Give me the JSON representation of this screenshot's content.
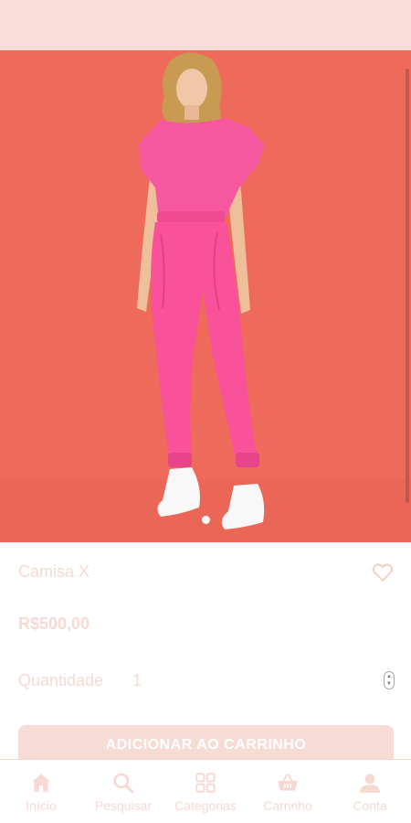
{
  "product": {
    "name": "Camisa X",
    "price": "R$500,00",
    "quantity_label": "Quantidade",
    "quantity_value": "1",
    "add_to_cart_label": "ADICIONAR AO CARRINHO",
    "image_icon": "pink-jumpsuit-photo",
    "carousel_current": 1,
    "carousel_total": 1
  },
  "nav": {
    "items": [
      {
        "label": "Início",
        "icon": "home-icon"
      },
      {
        "label": "Pesquisar",
        "icon": "search-icon"
      },
      {
        "label": "Categorias",
        "icon": "grid-icon"
      },
      {
        "label": "Carrinho",
        "icon": "basket-icon"
      },
      {
        "label": "Conta",
        "icon": "user-icon"
      }
    ]
  },
  "colors": {
    "accent": "#f7d9d3",
    "header": "#f9dfd9",
    "photo_background": "#ee6a5a",
    "garment": "#f9519a"
  }
}
